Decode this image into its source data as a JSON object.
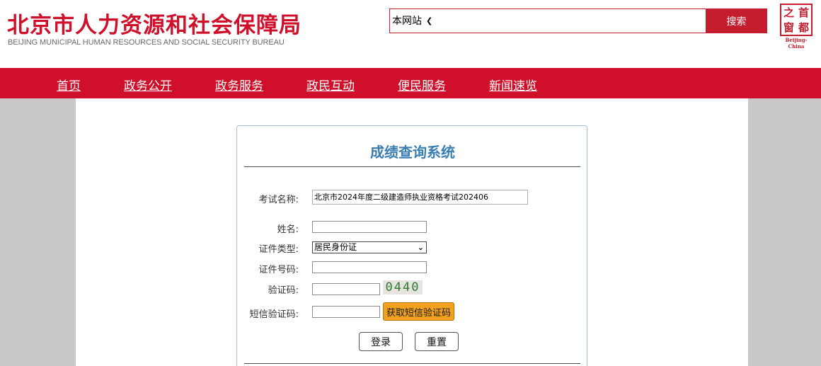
{
  "header": {
    "title_cn": "北京市人力资源和社会保障局",
    "title_en": "BEIJING MUNICIPAL HUMAN RESOURCES AND SOCIAL SECURITY BUREAU"
  },
  "search": {
    "scope": "本网站",
    "button": "搜索"
  },
  "seal": {
    "chars": [
      "之",
      "首",
      "窗",
      "都"
    ],
    "caption": "Beijing-China"
  },
  "nav": {
    "items": [
      {
        "label": "首页"
      },
      {
        "label": "政务公开"
      },
      {
        "label": "政务服务"
      },
      {
        "label": "政民互动"
      },
      {
        "label": "便民服务"
      },
      {
        "label": "新闻速览"
      }
    ]
  },
  "form": {
    "title": "成绩查询系统",
    "exam_label": "考试名称:",
    "exam_value": "北京市2024年度二级建造师执业资格考试202406",
    "name_label": "姓名:",
    "id_type_label": "证件类型:",
    "id_type_value": "居民身份证",
    "id_number_label": "证件号码:",
    "captcha_label": "验证码:",
    "captcha_value": "0440",
    "sms_label": "短信验证码:",
    "sms_button": "获取短信验证码",
    "login_button": "登录",
    "reset_button": "重置"
  },
  "colors": {
    "brand_red": "#d0102a",
    "title_blue": "#3b7eb0",
    "sms_orange": "#f2a11f"
  }
}
